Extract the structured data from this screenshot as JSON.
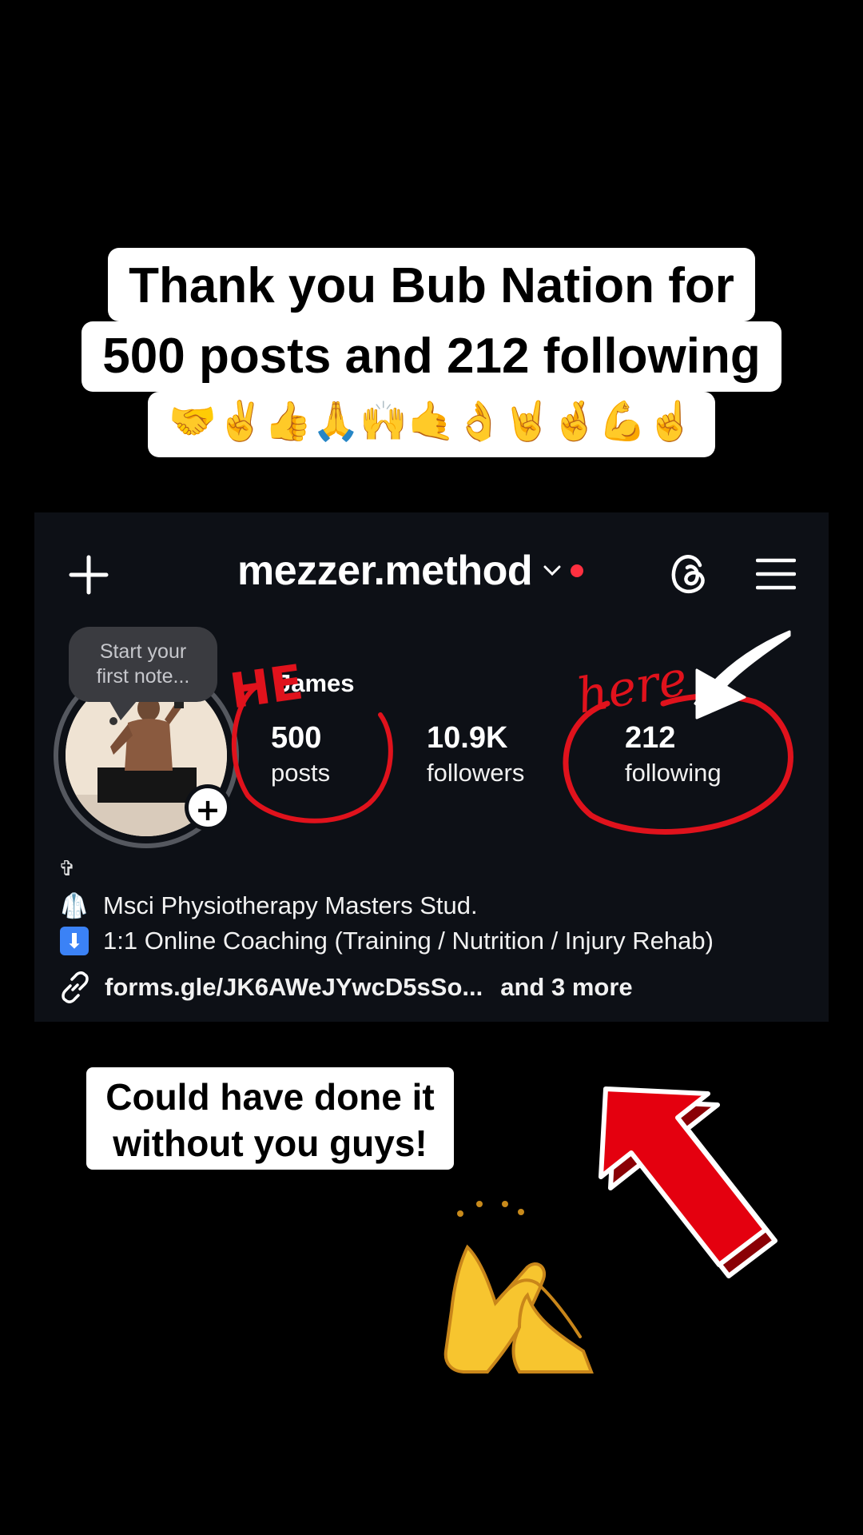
{
  "top_caption": {
    "line1": "Thank you Bub Nation for",
    "line2": "500 posts and 212 following",
    "emoji_line": "🤝✌️👍🙏🙌🤙👌🤘🤞💪☝️"
  },
  "profile": {
    "username": "mezzer.method",
    "note_bubble": [
      "Start your",
      "first note..."
    ],
    "display_name": "James",
    "stats": {
      "posts": {
        "value": "500",
        "label": "posts"
      },
      "followers": {
        "value": "10.9K",
        "label": "followers"
      },
      "following": {
        "value": "212",
        "label": "following"
      }
    },
    "bio": {
      "cross": "✞",
      "line1_emoji": "🥼",
      "line1": "Msci Physiotherapy Masters Stud.",
      "line2_emoji": "⬇",
      "line2": "1:1 Online Coaching (Training / Nutrition / Injury Rehab)",
      "link": "forms.gle/JK6AWeJYwcD5sSo...",
      "link_more": "and 3 more"
    }
  },
  "annotations": {
    "he_text": "HE",
    "here_text": "here",
    "ink_color": "#e0121c"
  },
  "bottom_caption": {
    "line1": "Could have done it",
    "line2": "without you guys!"
  },
  "icons": [
    "plus-icon",
    "chevron-down-icon",
    "notification-dot",
    "threads-icon",
    "menu-icon",
    "link-icon",
    "clapping-hands-icon",
    "red-arrow-icon"
  ]
}
